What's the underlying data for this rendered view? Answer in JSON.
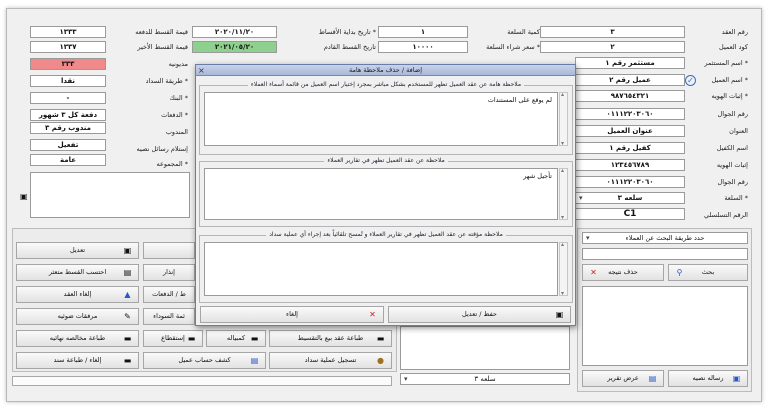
{
  "form": {
    "contract_no_label": "رقم العقد",
    "contract_no": "٣",
    "client_code_label": "كود العميل",
    "client_code": "٢",
    "investor_name_label": "* اسم المستثمر",
    "investor_name": "مستثمر رقم ١",
    "client_name_label": "* اسم العميل",
    "client_name": "عميل رقم ٢",
    "id_proof_label": "* إثبات الهويه",
    "id_proof": "٩٨٧٦٥٤٣٢١",
    "mobile_label": "رقم الجوال",
    "mobile": "٠١١١٢٢٠٣٠٦٠",
    "address_label": "العنوان",
    "address": "عنوان العميل",
    "guarantor_label": "اسم الكفيل",
    "guarantor": "كفيل رقم ١",
    "guarantor_id_label": "إثبات الهويه",
    "guarantor_id": "١٢٣٤٥٦٧٨٩",
    "guarantor_mobile_label": "رقم الجوال",
    "guarantor_mobile": "٠١١١٢٢٠٣٠٦٠",
    "goods_label": "* السلعة",
    "goods": "سلعه ٣",
    "serial_label": "الرقم التسلسلي",
    "serial": "C1",
    "qty_label": "كمية السلعة",
    "qty": "١",
    "price_label": "* سعر شراء السلعة",
    "price": "١٠٠٠٠",
    "start_date_label": "* تاريخ بداية الأقساط",
    "start_date": "٢٠٢٠/١١/٢٠",
    "next_date_label": "تاريخ القسط القادم",
    "next_date": "٢٠٢١/٠٥/٢٠",
    "first_inst_label": "قيمة القسط للدفعه",
    "first_inst": "١٣٣٣",
    "last_inst_label": "قيمة القسط الأخير",
    "last_inst": "١٣٣٧",
    "debt_label": "مديونيه",
    "debt": "٣٣٣",
    "pay_method_label": "* طريقة السداد",
    "pay_method": "نقدا",
    "bank_label": "* البنك",
    "bank": "-",
    "payments_label": "* الدفعات",
    "payments": "دفعة كل ٣ شهور",
    "delegate_label": "المندوب",
    "delegate": "مندوب رقم ٣",
    "advice_label": "إستلام رسائل نصيه",
    "advice": "تفعيل",
    "group_label": "* المجموعه",
    "group": "عامة"
  },
  "buttons": {
    "edit": "تعديل",
    "calc_late": "احتسب القسط متعثر",
    "warn": "إنذار",
    "cancel_contract": "إلغاء العقد",
    "payments_btn": "ط / الدفعات",
    "attachments": "مرفقات ضوئيه",
    "blacklist": "ئمة السوداء",
    "print_clearance": "طباعة مخالصه نهائيه",
    "deduct": "إستقطاع",
    "bill": "كمبياله",
    "print_installment": "طباعة عقد بيع بالتقسيط",
    "cancel_print_bond": "إلغاء / طباعة سند",
    "statement": "كشف حساب عميل",
    "record_payment": "تسجيل عملية سداد"
  },
  "search": {
    "mode": "حدد طريقة البحث عن العملاء",
    "search_btn": "بحث",
    "delete_btn": "حذف نتيجه",
    "sms_btn": "رساله نصيه",
    "report_btn": "عرض تقرير",
    "goods_select": "سلعه ٣"
  },
  "dialog": {
    "title": "إضافة / حذف ملاحظة هامة",
    "note1_caption": "ملاحظة هامة عن عقد العميل تظهر للمستخدم بشكل مباشر بمجرد إختيار اسم العميل من قائمة أسماء العملاء",
    "note1_text": "لم يوقع على المستندات",
    "note2_caption": "ملاحظة عن عقد العميل تظهر في تقارير العملاء",
    "note2_text": "تأجيل شهر",
    "note3_caption": "ملاحظة مؤقته عن عقد العميل تظهر في تقارير العملاء و تُمسح تلقائياً بعد إجراء أي عملية سداد",
    "note3_text": "",
    "save_btn": "حفظ / تعديل",
    "cancel_btn": "إلغاء"
  }
}
